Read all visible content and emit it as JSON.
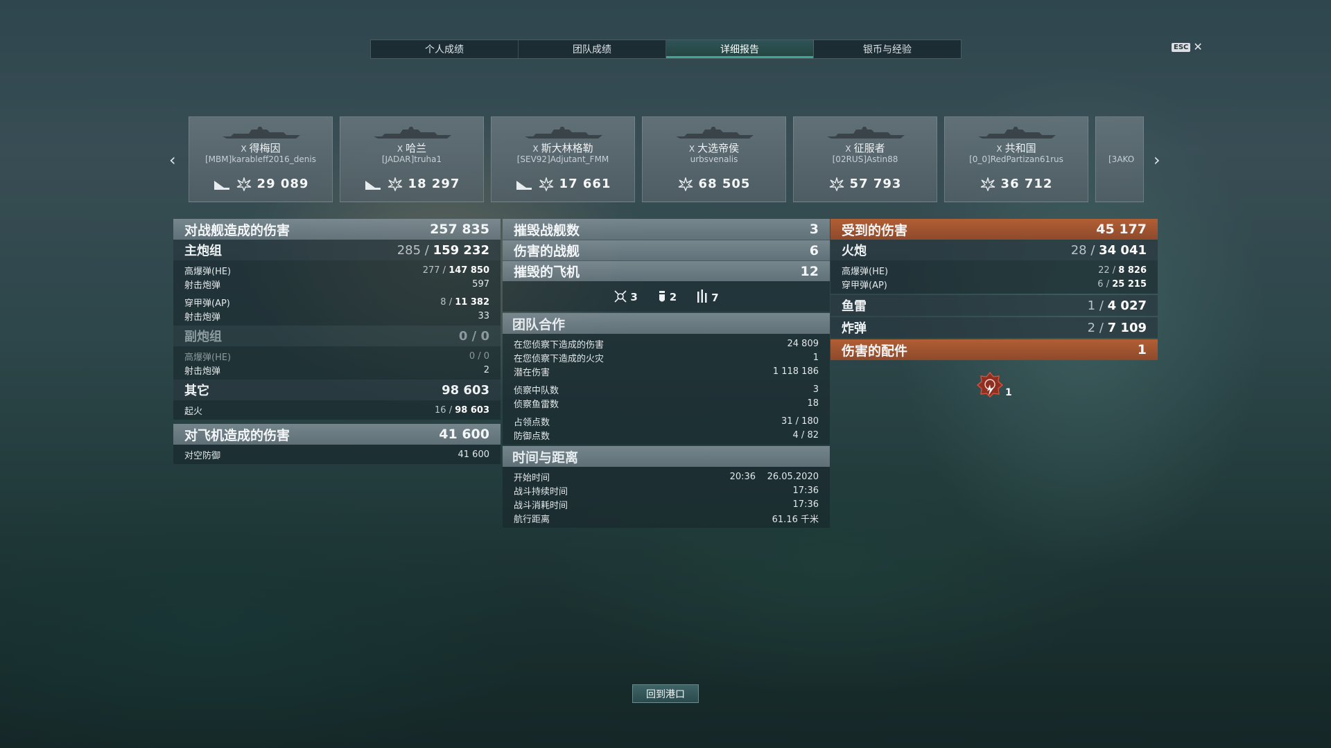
{
  "tabs": [
    {
      "label": "个人成绩",
      "active": false
    },
    {
      "label": "团队成绩",
      "active": false
    },
    {
      "label": "详细报告",
      "active": true
    },
    {
      "label": "银币与经验",
      "active": false
    }
  ],
  "esc": {
    "key": "ESC",
    "close": "✕"
  },
  "carousel": {
    "prev": "‹",
    "next": "›",
    "ships": [
      {
        "tier": "X",
        "name": "得梅因",
        "player": "[MBM]karableff2016_denis",
        "damage": "29 089",
        "sunk_icon": true
      },
      {
        "tier": "X",
        "name": "哈兰",
        "player": "[JADAR]truha1",
        "damage": "18 297",
        "sunk_icon": true
      },
      {
        "tier": "X",
        "name": "斯大林格勒",
        "player": "[SEV92]Adjutant_FMM",
        "damage": "17 661",
        "sunk_icon": true
      },
      {
        "tier": "X",
        "name": "大选帝侯",
        "player": "urbsvenalis",
        "damage": "68 505",
        "sunk_icon": false
      },
      {
        "tier": "X",
        "name": "征服者",
        "player": "[02RUS]Astin88",
        "damage": "57 793",
        "sunk_icon": false
      },
      {
        "tier": "X",
        "name": "共和国",
        "player": "[0_0]RedPartizan61rus",
        "damage": "36 712",
        "sunk_icon": false
      },
      {
        "tier": "",
        "name": "",
        "player": "[3AKO",
        "damage": "",
        "sunk_icon": false
      }
    ]
  },
  "left": {
    "header": {
      "label": "对战舰造成的伤害",
      "value": "257 835"
    },
    "main_battery": {
      "label": "主炮组",
      "hits": "285",
      "value": "159 232"
    },
    "he": {
      "label": "高爆弹(HE)",
      "hits": "277",
      "value": "147 850"
    },
    "he_shots": {
      "label": "射击炮弹",
      "value": "597"
    },
    "ap": {
      "label": "穿甲弹(AP)",
      "hits": "8",
      "value": "11 382"
    },
    "ap_shots": {
      "label": "射击炮弹",
      "value": "33"
    },
    "secondary": {
      "label": "副炮组",
      "value": "0 / 0"
    },
    "sec_he": {
      "label": "高爆弹(HE)",
      "value": "0 / 0"
    },
    "sec_shots": {
      "label": "射击炮弹",
      "value": "2"
    },
    "other": {
      "label": "其它",
      "value": "98 603"
    },
    "fire": {
      "label": "起火",
      "hits": "16",
      "value": "98 603"
    },
    "aa_header": {
      "label": "对飞机造成的伤害",
      "value": "41 600"
    },
    "aa_def": {
      "label": "对空防御",
      "value": "41 600"
    }
  },
  "middle": {
    "destroyed_ships": {
      "label": "摧毁战舰数",
      "value": "3"
    },
    "damaged_ships": {
      "label": "伤害的战舰",
      "value": "6"
    },
    "destroyed_planes": {
      "label": "摧毁的飞机",
      "value": "12"
    },
    "plane_icons": [
      {
        "icon": "fighter-icon",
        "count": "3"
      },
      {
        "icon": "bomber-icon",
        "count": "2"
      },
      {
        "icon": "torpedo-bomber-icon",
        "count": "7"
      }
    ],
    "team": {
      "title": "团队合作",
      "spot_damage": {
        "label": "在您侦察下造成的伤害",
        "value": "24 809"
      },
      "spot_fires": {
        "label": "在您侦察下造成的火灾",
        "value": "1"
      },
      "potential": {
        "label": "潜在伤害",
        "value": "1 118 186"
      },
      "spotted_squads": {
        "label": "侦察中队数",
        "value": "3"
      },
      "spotted_torps": {
        "label": "侦察鱼雷数",
        "value": "18"
      },
      "capture": {
        "label": "占领点数",
        "value": "31 / 180"
      },
      "defense": {
        "label": "防御点数",
        "value": "4 / 82"
      }
    },
    "time": {
      "title": "时间与距离",
      "start": {
        "label": "开始时间",
        "time": "20:36",
        "date": "26.05.2020"
      },
      "duration": {
        "label": "战斗持续时间",
        "value": "17:36"
      },
      "elapsed": {
        "label": "战斗消耗时间",
        "value": "17:36"
      },
      "distance": {
        "label": "航行距离",
        "value": "61.16 千米"
      }
    }
  },
  "right": {
    "header": {
      "label": "受到的伤害",
      "value": "45 177"
    },
    "guns": {
      "label": "火炮",
      "hits": "28",
      "value": "34 041"
    },
    "he": {
      "label": "高爆弹(HE)",
      "hits": "22",
      "value": "8 826"
    },
    "ap": {
      "label": "穿甲弹(AP)",
      "hits": "6",
      "value": "25 215"
    },
    "torpedo": {
      "label": "鱼雷",
      "hits": "1",
      "value": "4 027"
    },
    "bomb": {
      "label": "炸弹",
      "hits": "2",
      "value": "7 109"
    },
    "modules": {
      "label": "伤害的配件",
      "value": "1"
    },
    "module_icon_count": "1"
  },
  "footer": {
    "return_port": "回到港口"
  },
  "colors": {
    "accent": "#3fa59a",
    "orange": "#b25e34"
  }
}
